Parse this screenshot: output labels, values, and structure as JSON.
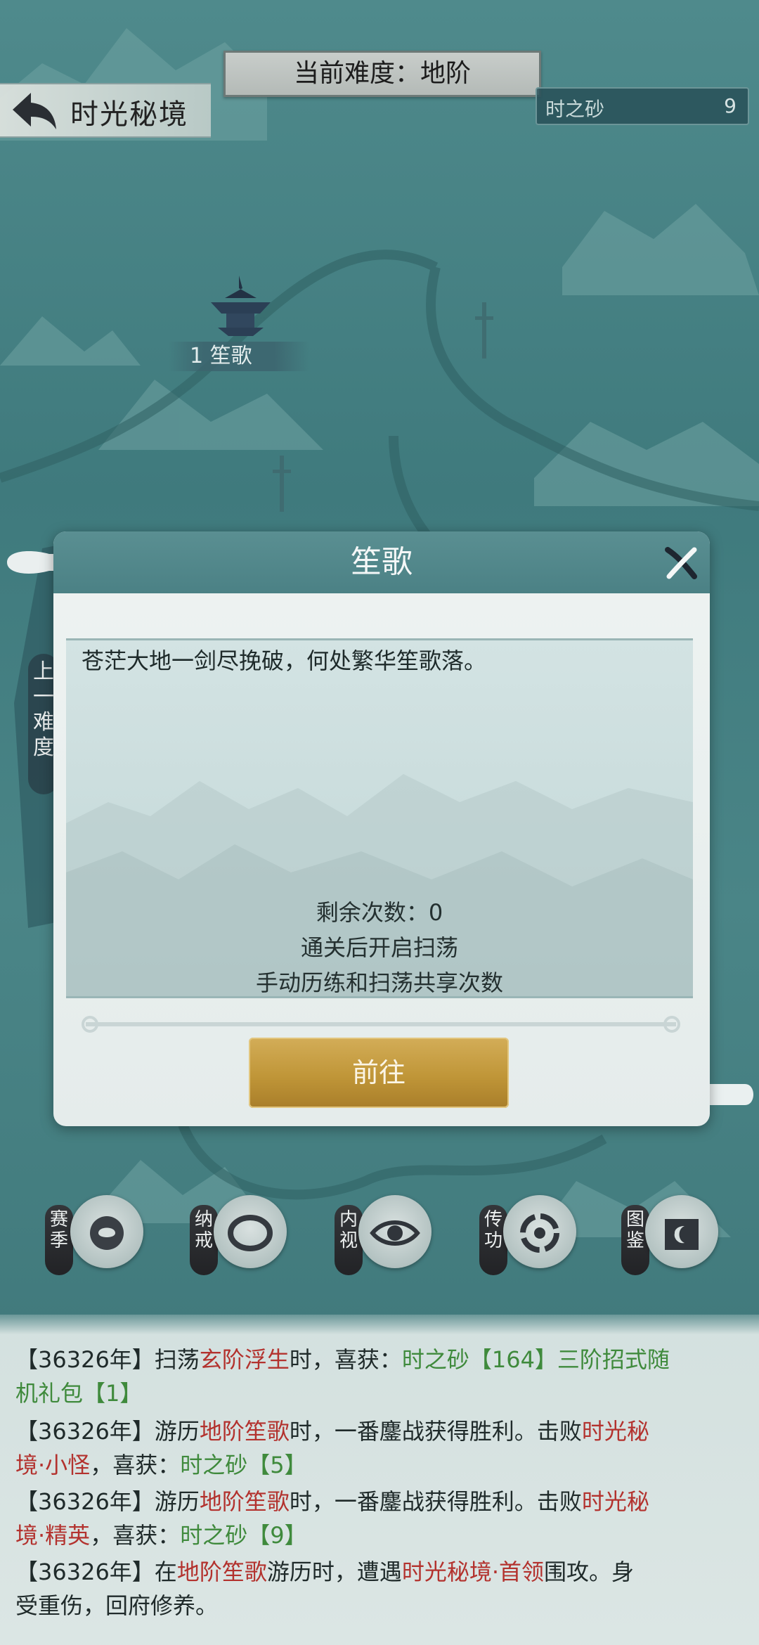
{
  "header": {
    "back_title": "时光秘境",
    "difficulty": "当前难度：地阶",
    "currency_name": "时之砂",
    "currency_count": "9"
  },
  "map": {
    "node_label": "1 笙歌",
    "side_tab": "上一难度"
  },
  "dialog": {
    "title": "笙歌",
    "poem": "苍茫大地一剑尽挽破，何处繁华笙歌落。",
    "remaining": "剩余次数：0",
    "sweep_note": "通关后开启扫荡",
    "share_note": "手动历练和扫荡共享次数",
    "go_button": "前往"
  },
  "tools": [
    {
      "tag": "赛季",
      "icon": "season-icon"
    },
    {
      "tag": "纳戒",
      "icon": "ring-icon"
    },
    {
      "tag": "内视",
      "icon": "eye-icon"
    },
    {
      "tag": "传功",
      "icon": "transfer-icon"
    },
    {
      "tag": "图鉴",
      "icon": "book-icon"
    }
  ],
  "log": {
    "line1": {
      "a": "【36326年】扫荡",
      "b": "玄阶浮生",
      "c": "时，喜获：",
      "d": "时之砂【164】三阶招式随",
      "e": "机礼包【1】"
    },
    "line2": {
      "a": "【36326年】游历",
      "b": "地阶笙歌",
      "c": "时，一番鏖战获得胜利。击败",
      "d": "时光秘",
      "e": "境·小怪",
      "f": "，喜获：",
      "g": "时之砂【5】"
    },
    "line3": {
      "a": "【36326年】游历",
      "b": "地阶笙歌",
      "c": "时，一番鏖战获得胜利。击败",
      "d": "时光秘",
      "e": "境·精英",
      "f": "，喜获：",
      "g": "时之砂【9】"
    },
    "line4": {
      "a": "【36326年】在",
      "b": "地阶笙歌",
      "c": "游历时，遭遇",
      "d": "时光秘境·首领",
      "e": "围攻。身",
      "f": "受重伤，回府修养。"
    }
  }
}
